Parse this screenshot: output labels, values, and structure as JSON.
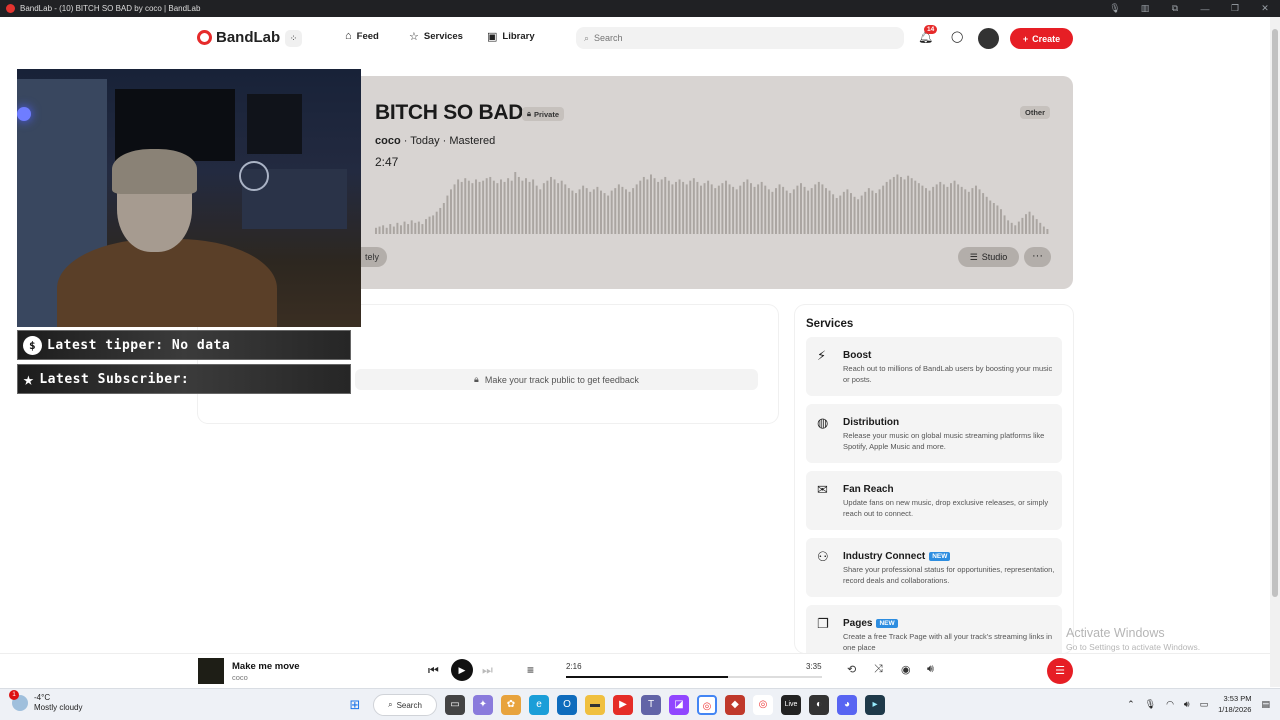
{
  "browser": {
    "tab_title": "BandLab - (10) BITCH SO BAD by coco | BandLab"
  },
  "nav": {
    "logo": "BandLab",
    "links": [
      {
        "label": "Feed",
        "icon": "home-icon"
      },
      {
        "label": "Services",
        "icon": "star-icon"
      },
      {
        "label": "Library",
        "icon": "library-icon"
      }
    ],
    "search_placeholder": "Search",
    "notification_count": "14",
    "create_label": "Create"
  },
  "track": {
    "title": "BITCH SO BAD",
    "privacy": "Private",
    "artist": "coco",
    "meta_rest": " · Today · Mastered",
    "duration": "2:47",
    "genre": "Other",
    "partial_button": "tely",
    "studio_label": "Studio",
    "more_label": "···",
    "waveform": [
      0.1,
      0.12,
      0.14,
      0.1,
      0.16,
      0.12,
      0.18,
      0.14,
      0.2,
      0.16,
      0.22,
      0.18,
      0.2,
      0.16,
      0.24,
      0.28,
      0.3,
      0.36,
      0.42,
      0.5,
      0.62,
      0.72,
      0.8,
      0.88,
      0.84,
      0.9,
      0.86,
      0.82,
      0.88,
      0.84,
      0.86,
      0.9,
      0.92,
      0.86,
      0.82,
      0.88,
      0.84,
      0.9,
      0.86,
      1.0,
      0.92,
      0.86,
      0.9,
      0.84,
      0.88,
      0.78,
      0.72,
      0.82,
      0.86,
      0.92,
      0.88,
      0.82,
      0.86,
      0.8,
      0.74,
      0.7,
      0.66,
      0.72,
      0.78,
      0.74,
      0.68,
      0.72,
      0.76,
      0.7,
      0.66,
      0.62,
      0.7,
      0.74,
      0.8,
      0.76,
      0.72,
      0.68,
      0.74,
      0.8,
      0.86,
      0.92,
      0.88,
      0.96,
      0.9,
      0.84,
      0.88,
      0.92,
      0.86,
      0.8,
      0.84,
      0.88,
      0.84,
      0.8,
      0.86,
      0.9,
      0.84,
      0.78,
      0.82,
      0.86,
      0.8,
      0.74,
      0.78,
      0.82,
      0.86,
      0.8,
      0.76,
      0.72,
      0.78,
      0.84,
      0.88,
      0.82,
      0.76,
      0.8,
      0.84,
      0.78,
      0.72,
      0.68,
      0.74,
      0.8,
      0.76,
      0.7,
      0.66,
      0.72,
      0.78,
      0.82,
      0.76,
      0.7,
      0.74,
      0.8,
      0.84,
      0.8,
      0.74,
      0.7,
      0.64,
      0.58,
      0.62,
      0.68,
      0.72,
      0.66,
      0.6,
      0.56,
      0.62,
      0.68,
      0.74,
      0.7,
      0.66,
      0.72,
      0.78,
      0.84,
      0.88,
      0.92,
      0.96,
      0.92,
      0.88,
      0.94,
      0.9,
      0.86,
      0.82,
      0.78,
      0.74,
      0.7,
      0.76,
      0.8,
      0.84,
      0.8,
      0.76,
      0.82,
      0.86,
      0.8,
      0.76,
      0.72,
      0.68,
      0.74,
      0.78,
      0.72,
      0.66,
      0.6,
      0.54,
      0.5,
      0.46,
      0.4,
      0.3,
      0.22,
      0.18,
      0.14,
      0.2,
      0.26,
      0.32,
      0.36,
      0.3,
      0.24,
      0.18,
      0.12,
      0.08
    ],
    "feedback_notice": "Make your track public to get feedback"
  },
  "services": {
    "heading": "Services",
    "items": [
      {
        "title": "Boost",
        "new": "",
        "icon": "bolt-icon",
        "desc": "Reach out to millions of BandLab users by boosting your music or posts."
      },
      {
        "title": "Distribution",
        "new": "",
        "icon": "globe-icon",
        "desc": "Release your music on global music streaming platforms like Spotify, Apple Music and more."
      },
      {
        "title": "Fan Reach",
        "new": "",
        "icon": "mail-icon",
        "desc": "Update fans on new music, drop exclusive releases, or simply reach out to connect."
      },
      {
        "title": "Industry Connect",
        "new": "NEW",
        "icon": "people-icon",
        "desc": "Share your professional status for opportunities, representation, record deals and collaborations."
      },
      {
        "title": "Pages",
        "new": "NEW",
        "icon": "pages-icon",
        "desc": "Create a free Track Page with all your track's streaming links in one place"
      }
    ]
  },
  "stream_overlay": {
    "tipper": "Latest tipper: No data",
    "subscriber": "Latest Subscriber:"
  },
  "player": {
    "title": "Make me move",
    "artist": "coco",
    "current_time": "2:16",
    "total_time": "3:35",
    "progress": 0.633
  },
  "activate_windows": {
    "title": "Activate Windows",
    "subtitle": "Go to Settings to activate Windows."
  },
  "taskbar": {
    "weather_temp": "-4°C",
    "weather_desc": "Mostly cloudy",
    "weather_badge": "1",
    "search_label": "Search",
    "time": "3:53 PM",
    "date": "1/18/2026"
  }
}
